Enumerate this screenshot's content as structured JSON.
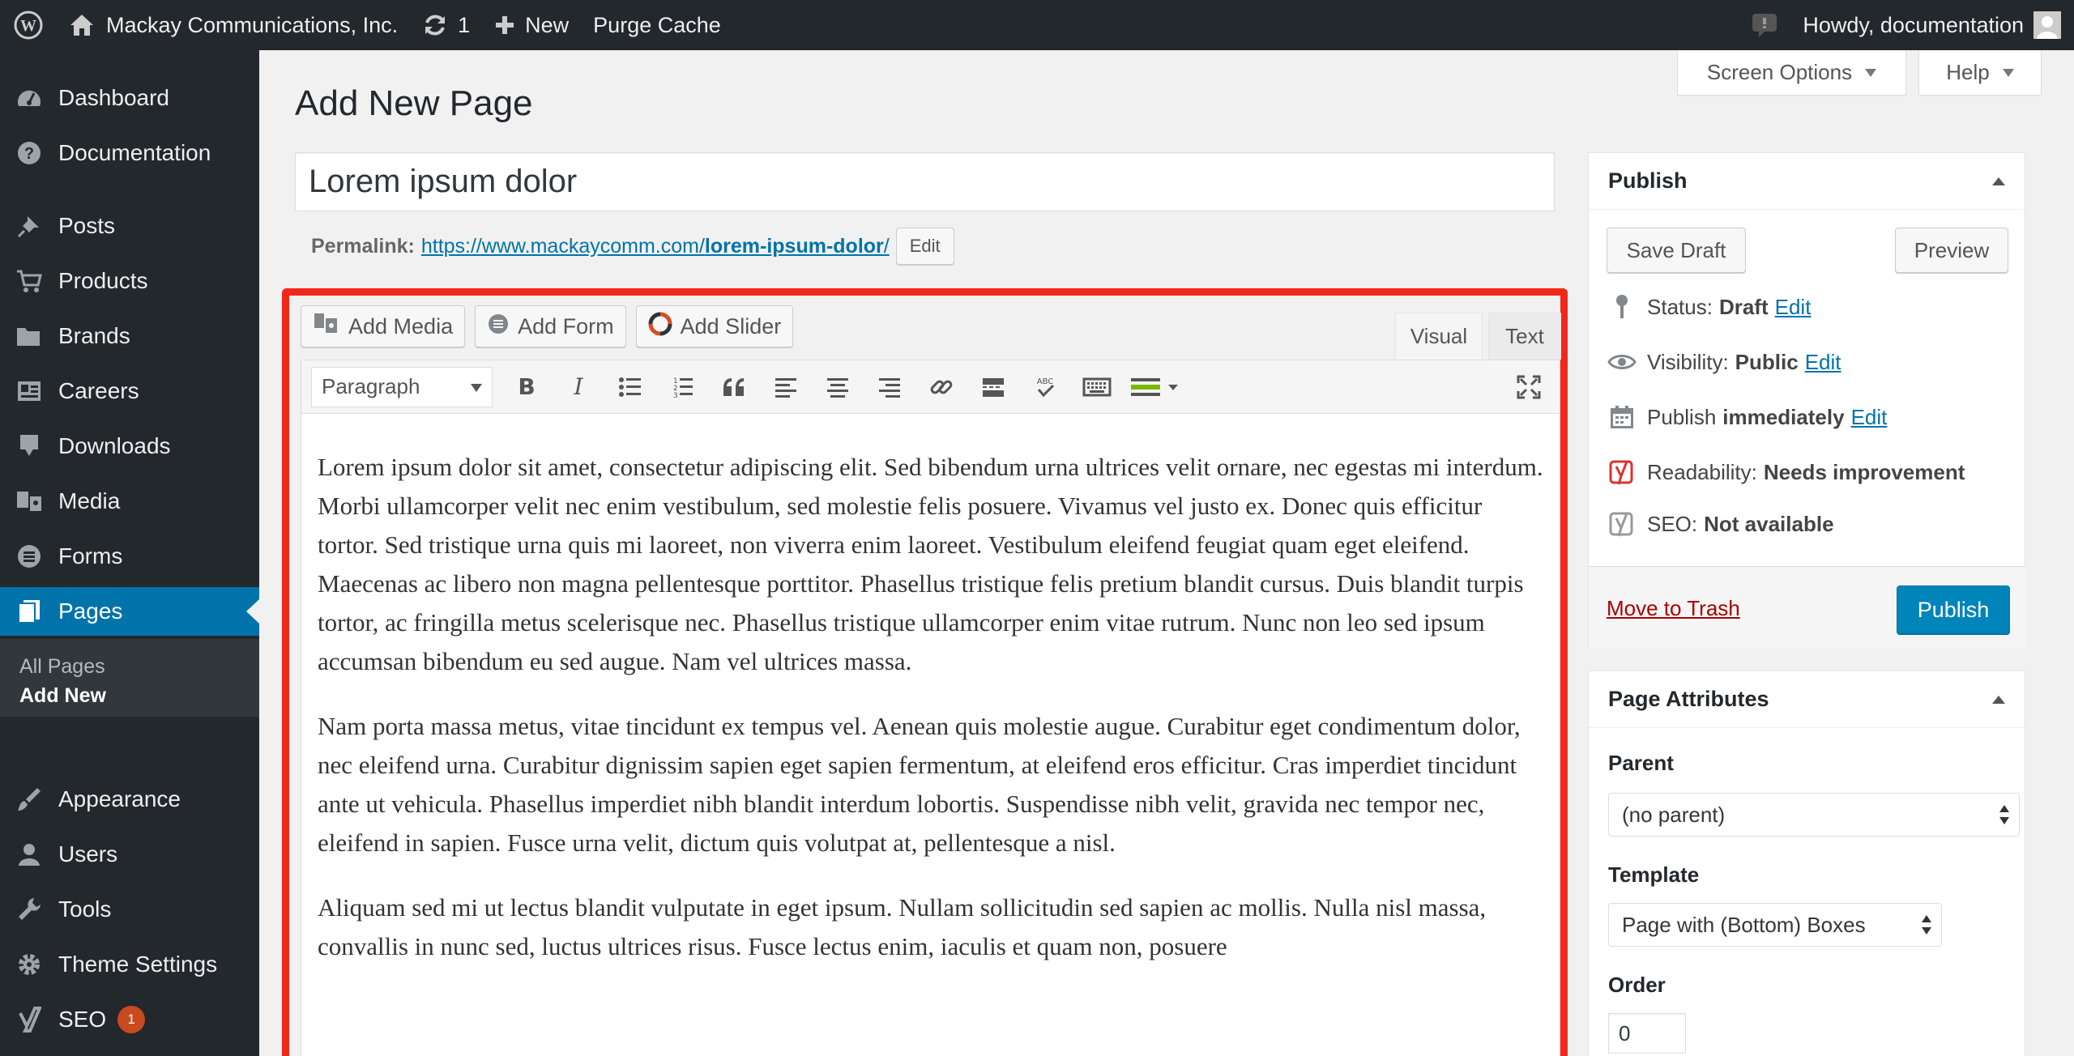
{
  "admin_bar": {
    "site_name": "Mackay Communications, Inc.",
    "updates_count": "1",
    "new_label": "New",
    "purge_label": "Purge Cache",
    "howdy": "Howdy, documentation"
  },
  "sidebar": {
    "items": [
      {
        "label": "Dashboard",
        "icon": "dashboard-icon"
      },
      {
        "label": "Documentation",
        "icon": "help-icon"
      },
      {
        "label": "Posts",
        "icon": "pin-icon"
      },
      {
        "label": "Products",
        "icon": "cart-icon"
      },
      {
        "label": "Brands",
        "icon": "folder-icon"
      },
      {
        "label": "Careers",
        "icon": "id-card-icon"
      },
      {
        "label": "Downloads",
        "icon": "download-icon"
      },
      {
        "label": "Media",
        "icon": "media-icon"
      },
      {
        "label": "Forms",
        "icon": "forms-icon"
      },
      {
        "label": "Pages",
        "icon": "pages-icon"
      },
      {
        "label": "Appearance",
        "icon": "brush-icon"
      },
      {
        "label": "Users",
        "icon": "users-icon"
      },
      {
        "label": "Tools",
        "icon": "wrench-icon"
      },
      {
        "label": "Theme Settings",
        "icon": "gear-icon"
      },
      {
        "label": "SEO",
        "icon": "yoast-icon",
        "badge": "1"
      }
    ],
    "submenu": {
      "all_pages": "All Pages",
      "add_new": "Add New"
    }
  },
  "screen_options": {
    "screen_options_label": "Screen Options",
    "help_label": "Help"
  },
  "heading": "Add New Page",
  "title_value": "Lorem ipsum dolor",
  "permalink": {
    "label": "Permalink:",
    "url_base": "https://www.mackaycomm.com/",
    "slug": "lorem-ipsum-dolor",
    "trailing": "/",
    "edit_label": "Edit"
  },
  "editor": {
    "media_buttons": {
      "add_media": "Add Media",
      "add_form": "Add Form",
      "add_slider": "Add Slider"
    },
    "tabs": {
      "visual": "Visual",
      "text": "Text"
    },
    "format_value": "Paragraph",
    "content": [
      "Lorem ipsum dolor sit amet, consectetur adipiscing elit. Sed bibendum urna ultrices velit ornare, nec egestas mi interdum. Morbi ullamcorper velit nec enim vestibulum, sed molestie felis posuere. Vivamus vel justo ex. Donec quis efficitur tortor. Sed tristique urna quis mi laoreet, non viverra enim laoreet. Vestibulum eleifend feugiat quam eget eleifend. Maecenas ac libero non magna pellentesque porttitor. Phasellus tristique felis pretium blandit cursus. Duis blandit turpis tortor, ac fringilla metus scelerisque nec. Phasellus tristique ullamcorper enim vitae rutrum. Nunc non leo sed ipsum accumsan bibendum eu sed augue. Nam vel ultrices massa.",
      "Nam porta massa metus, vitae tincidunt ex tempus vel. Aenean quis molestie augue. Curabitur eget condimentum dolor, nec eleifend urna. Curabitur dignissim sapien eget sapien fermentum, at eleifend eros efficitur. Cras imperdiet tincidunt ante ut vehicula. Phasellus imperdiet nibh blandit interdum lobortis. Suspendisse nibh velit, gravida nec tempor nec, eleifend in sapien. Fusce urna velit, dictum quis volutpat at, pellentesque a nisl.",
      "Aliquam sed mi ut lectus blandit vulputate in eget ipsum. Nullam sollicitudin sed sapien ac mollis. Nulla nisl massa, convallis in nunc sed, luctus ultrices risus. Fusce lectus enim, iaculis et quam non, posuere"
    ],
    "highlight_color": "#f2271a"
  },
  "publish": {
    "title": "Publish",
    "save_draft": "Save Draft",
    "preview": "Preview",
    "status_label": "Status:",
    "status_value": "Draft",
    "visibility_label": "Visibility:",
    "visibility_value": "Public",
    "publish_label": "Publish",
    "publish_value": "immediately",
    "edit_link": "Edit",
    "readability_label": "Readability:",
    "readability_value": "Needs improvement",
    "seo_label": "SEO:",
    "seo_value": "Not available",
    "trash": "Move to Trash",
    "publish_button": "Publish"
  },
  "page_attributes": {
    "title": "Page Attributes",
    "parent_label": "Parent",
    "parent_value": "(no parent)",
    "template_label": "Template",
    "template_value": "Page with (Bottom) Boxes",
    "order_label": "Order",
    "order_value": "0"
  }
}
